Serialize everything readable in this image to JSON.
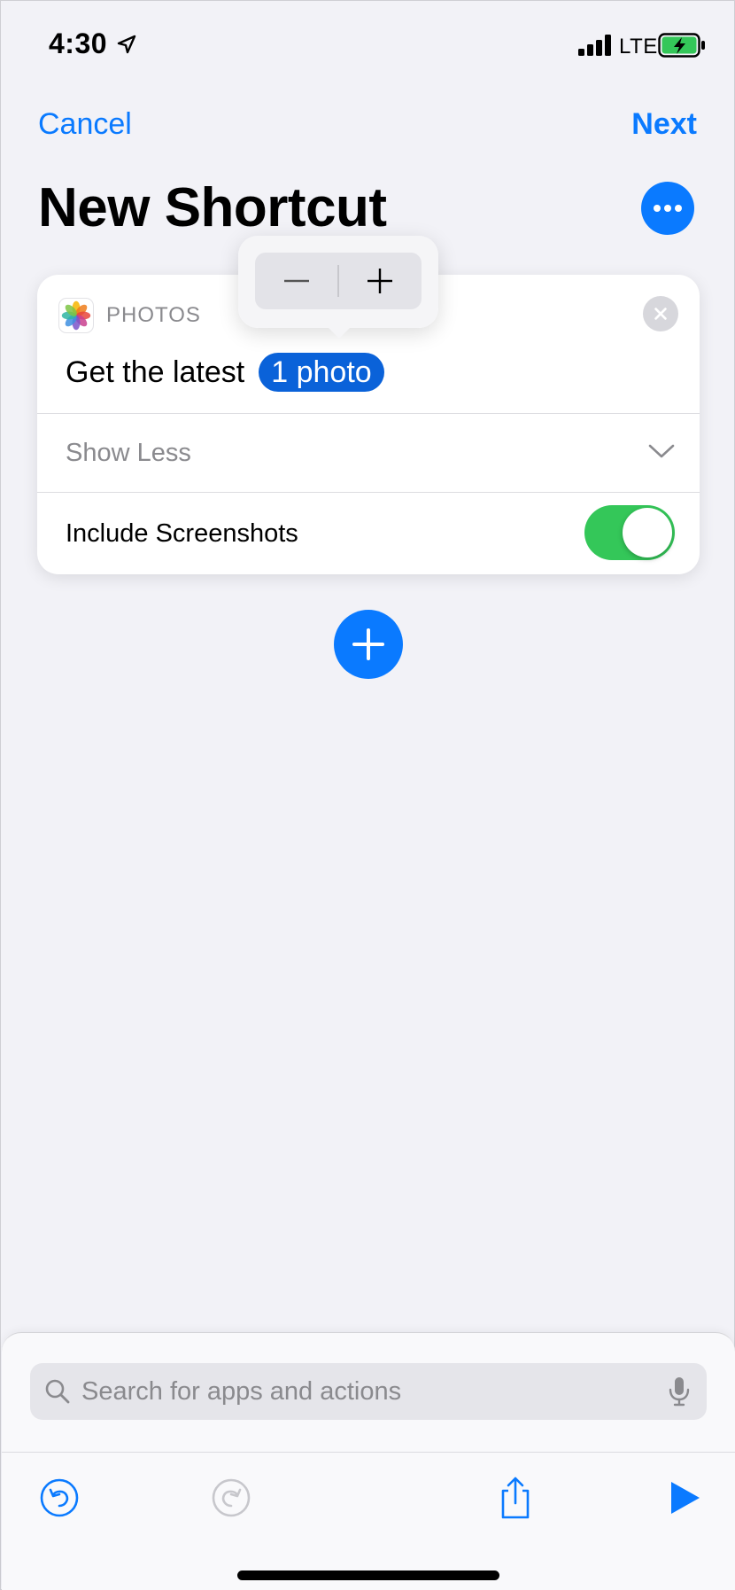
{
  "status_bar": {
    "time": "4:30",
    "network": "LTE",
    "icons": [
      "location-arrow-icon",
      "signal-bars-icon",
      "battery-charging-icon"
    ]
  },
  "nav": {
    "cancel_label": "Cancel",
    "next_label": "Next",
    "title": "New Shortcut",
    "more_icon": "ellipsis-icon"
  },
  "action_card": {
    "app_label": "PHOTOS",
    "app_icon": "photos-app-icon",
    "sentence": "Get the latest",
    "token_label": "1 photo",
    "show_less_label": "Show Less",
    "toggle_label": "Include Screenshots",
    "toggle_on": true
  },
  "stepper": {
    "decrement_icon": "minus-icon",
    "increment_icon": "plus-icon"
  },
  "bottom_sheet": {
    "search_placeholder": "Search for apps and actions",
    "toolbar": [
      "undo-icon",
      "redo-icon",
      "share-icon",
      "play-icon"
    ]
  },
  "colors": {
    "accent": "#0a7aff",
    "token": "#0a62d9",
    "toggle_on": "#34c759",
    "background": "#f2f2f7"
  }
}
